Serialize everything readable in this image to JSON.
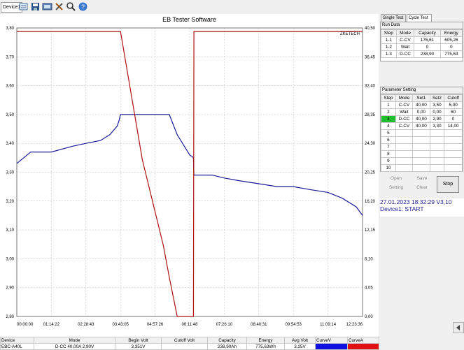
{
  "toolbar": {
    "device_tab": "Device1",
    "icons": [
      "device-list-icon",
      "open-file-icon",
      "save-icon",
      "monitor-icon",
      "tools-icon",
      "search-icon",
      "help-icon"
    ]
  },
  "plot": {
    "title": "EB Tester Software",
    "watermark": "ZKETECH",
    "left_axis_ticks": [
      "3,80",
      "3,70",
      "3,60",
      "3,50",
      "3,40",
      "3,30",
      "3,20",
      "3,10",
      "3,00",
      "2,90",
      "2,80"
    ],
    "right_axis_ticks": [
      "40,50",
      "36,45",
      "32,40",
      "28,35",
      "24,30",
      "20,25",
      "16,20",
      "12,15",
      "8,10",
      "4,05",
      "0,00"
    ],
    "x_axis_ticks": [
      "00:00:00",
      "01:14:22",
      "02:28:43",
      "03:43:05",
      "04:57:26",
      "06:11:48",
      "07:26:10",
      "08:40:31",
      "09:54:53",
      "11:09:14",
      "12:23:36"
    ],
    "colors": {
      "voltage": "#1a1a9a",
      "current": "#b01010",
      "grid": "#b8b8b8"
    }
  },
  "chart_data": {
    "type": "line",
    "x": [
      "00:00:00",
      "00:30:00",
      "01:00:00",
      "01:14:22",
      "02:00:00",
      "02:28:43",
      "03:00:00",
      "03:20:00",
      "03:36:00",
      "03:40:00",
      "03:43:05",
      "04:30:00",
      "05:15:00",
      "05:28:00",
      "05:45:00",
      "06:11:48",
      "06:20:00",
      "06:21:00",
      "07:00:00",
      "07:26:10",
      "08:00:00",
      "08:40:31",
      "09:20:00",
      "09:54:53",
      "10:30:00",
      "11:09:14",
      "11:40:00",
      "12:10:00",
      "12:23:36"
    ],
    "series": [
      {
        "name": "Voltage",
        "axis": "left",
        "values": [
          3.33,
          3.37,
          3.37,
          3.37,
          3.39,
          3.4,
          3.41,
          3.43,
          3.46,
          3.48,
          3.5,
          3.5,
          3.5,
          3.5,
          3.43,
          3.36,
          3.35,
          3.29,
          3.29,
          3.28,
          3.27,
          3.26,
          3.25,
          3.25,
          3.24,
          3.23,
          3.21,
          3.18,
          3.15
        ]
      },
      {
        "name": "Current",
        "axis": "right",
        "values": [
          40.0,
          40.0,
          40.0,
          40.0,
          40.0,
          40.0,
          40.0,
          40.0,
          40.0,
          40.0,
          40.0,
          22.0,
          10.0,
          5.5,
          0.0,
          0.0,
          0.0,
          40.0,
          40.0,
          40.0,
          40.0,
          40.0,
          40.0,
          40.0,
          40.0,
          40.0,
          40.0,
          40.0,
          40.0
        ]
      }
    ],
    "ylim_left": [
      2.8,
      3.8
    ],
    "ylim_right": [
      0.0,
      40.5
    ],
    "grid": true
  },
  "right": {
    "tabs": [
      "Single Test",
      "Cycle Test"
    ],
    "run_data": {
      "title": "Run Data",
      "headers": [
        "Step",
        "Mode",
        "Capacity",
        "Energy"
      ],
      "rows": [
        [
          "1-1",
          "C-CV",
          "176,61",
          "605,26"
        ],
        [
          "1-2",
          "Wait",
          "0",
          "0"
        ],
        [
          "1-3",
          "D-CC",
          "238,90",
          "775,63"
        ]
      ]
    },
    "params": {
      "title": "Parameter Setting",
      "headers": [
        "Step",
        "Mode",
        "Set1",
        "Set2",
        "Cutoff"
      ],
      "rows": [
        [
          "1",
          "C-CV",
          "40,00",
          "3,50",
          "5,00"
        ],
        [
          "2",
          "Wait",
          "0,00",
          "0,00",
          "60"
        ],
        [
          "3",
          "D-CC",
          "40,00",
          "2,90",
          "0"
        ],
        [
          "4",
          "C-CV",
          "40,00",
          "3,30",
          "14,00"
        ],
        [
          "5",
          "",
          "",
          "",
          ""
        ],
        [
          "6",
          "",
          "",
          "",
          ""
        ],
        [
          "7",
          "",
          "",
          "",
          ""
        ],
        [
          "8",
          "",
          "",
          "",
          ""
        ],
        [
          "9",
          "",
          "",
          "",
          ""
        ],
        [
          "10",
          "",
          "",
          "",
          ""
        ]
      ],
      "active_row": 2
    },
    "buttons": {
      "open": "Open",
      "save": "Save",
      "setting": "Setting",
      "clear": "Clear",
      "stop": "Stop"
    },
    "status": {
      "datetime": "27.01.2023 18:32:29  V3,10",
      "device_state": "Device1: START"
    }
  },
  "bottom": {
    "headers": [
      "Device",
      "Mode",
      "Begin Volt",
      "Cutoff Volt",
      "Capacity",
      "Energy",
      "Avg Volt",
      "CurveV",
      "CurveA"
    ],
    "row": [
      "EBC-A40L",
      "D-CC 40,00A 2,90V",
      "3,351V",
      "",
      "238,90Ah",
      "775,63Wh",
      "3,25V",
      "",
      ""
    ],
    "curve_colors": [
      "#1010e0",
      "#e01010"
    ]
  }
}
